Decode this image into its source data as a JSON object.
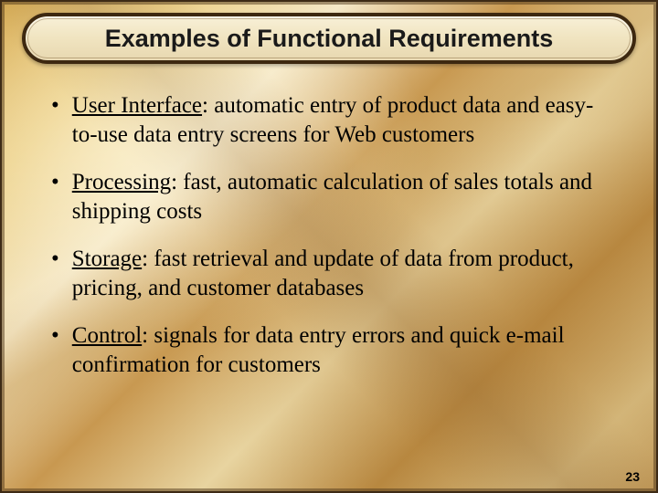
{
  "title": "Examples of Functional Requirements",
  "bullets": [
    {
      "label": "User Interface",
      "text": ": automatic entry of product data and easy-to-use data entry screens for Web customers"
    },
    {
      "label": "Processing",
      "text": ": fast, automatic calculation of sales totals and shipping costs"
    },
    {
      "label": "Storage",
      "text": ": fast retrieval and update of data from product, pricing, and customer databases"
    },
    {
      "label": "Control",
      "text": ": signals for data entry errors and quick e-mail confirmation for customers"
    }
  ],
  "page_number": "23"
}
